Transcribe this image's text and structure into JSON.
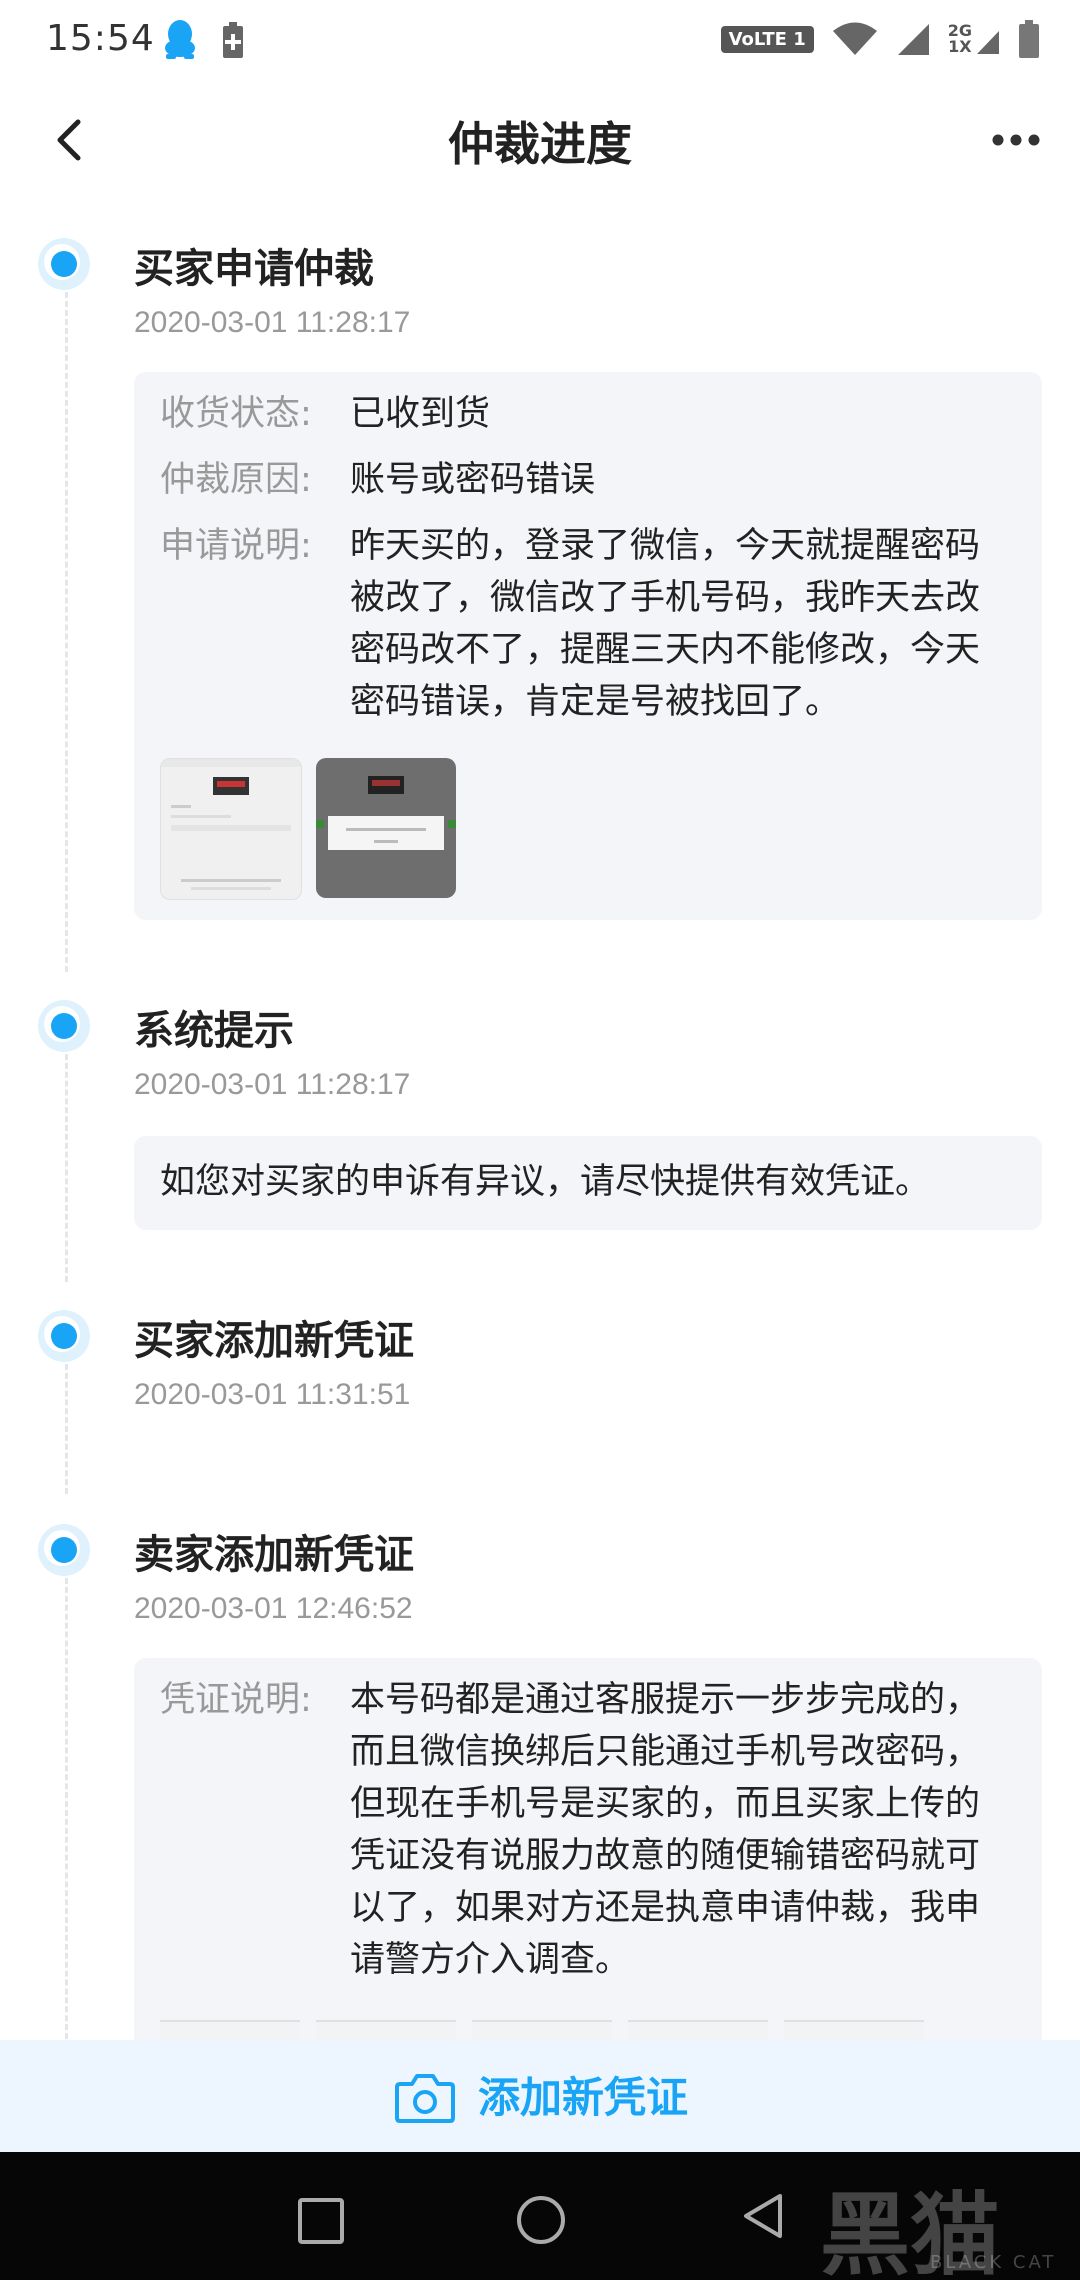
{
  "status_bar": {
    "time": "15:54",
    "volte": "VoLTE 1",
    "network_top": "2G",
    "network_bottom": "1X"
  },
  "header": {
    "title": "仲裁进度"
  },
  "timeline": [
    {
      "title": "买家申请仲裁",
      "time": "2020-03-01 11:28:17",
      "fields": [
        {
          "label": "收货状态:",
          "value": "已收到货"
        },
        {
          "label": "仲裁原因:",
          "value": "账号或密码错误"
        },
        {
          "label": "申请说明:",
          "value": "昨天买的，登录了微信，今天就提醒密码被改了，微信改了手机号码，我昨天去改密码改不了，提醒三天内不能修改，今天密码错误，肯定是号被找回了。"
        }
      ]
    },
    {
      "title": "系统提示",
      "time": "2020-03-01 11:28:17",
      "note": "如您对买家的申诉有异议，请尽快提供有效凭证。"
    },
    {
      "title": "买家添加新凭证",
      "time": "2020-03-01 11:31:51"
    },
    {
      "title": "卖家添加新凭证",
      "time": "2020-03-01 12:46:52",
      "fields": [
        {
          "label": "凭证说明:",
          "value": "本号码都是通过客服提示一步步完成的，而且微信换绑后只能通过手机号改密码，但现在手机号是买家的，而且买家上传的凭证没有说服力故意的随便输错密码就可以了，如果对方还是执意申请仲裁，我申请警方介入调查。"
        }
      ]
    }
  ],
  "action_bar": {
    "label": "添加新凭证"
  },
  "watermark": {
    "text": "黑猫",
    "sub": "BLACK CAT"
  },
  "colors": {
    "accent": "#1aa4f5",
    "card_bg": "#f4f5f8",
    "action_bg": "#edf6fe"
  }
}
